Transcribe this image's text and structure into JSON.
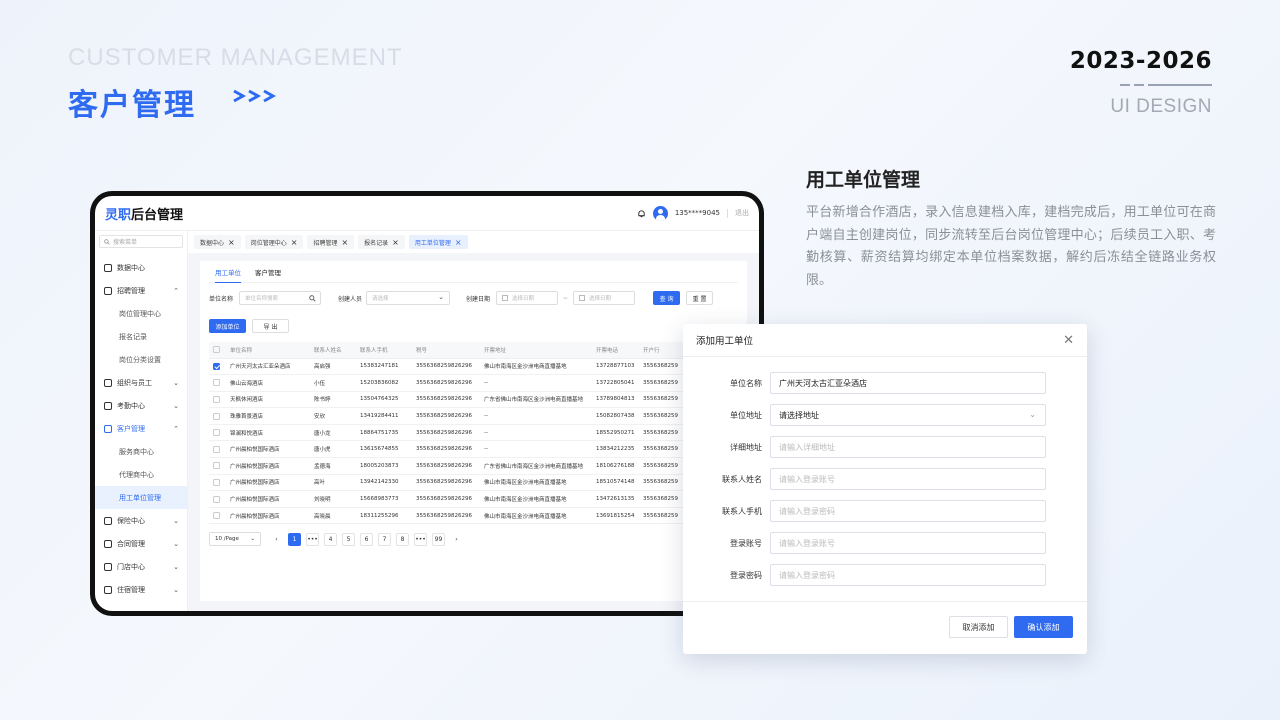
{
  "header": {
    "en_title": "CUSTOMER MANAGEMENT",
    "cn_title": "客户管理",
    "years": "2023-2026",
    "design": "UI DESIGN"
  },
  "description": {
    "title": "用工单位管理",
    "text": "平台新增合作酒店，录入信息建档入库，建档完成后，用工单位可在商户端自主创建岗位，同步流转至后台岗位管理中心；后续员工入职、考勤核算、薪资结算均绑定本单位档案数据，解约后冻结全链路业务权限。"
  },
  "app": {
    "logo_a": "灵职",
    "logo_b": "后台管理",
    "phone": "135****9045",
    "logout": "退出",
    "search_placeholder": "搜索菜单"
  },
  "sidebar": [
    {
      "label": "数据中心",
      "icon": "dashboard-icon",
      "chev": ""
    },
    {
      "label": "招聘管理",
      "icon": "recruit-icon",
      "chev": "⌃"
    },
    {
      "label": "岗位管理中心",
      "sub": true
    },
    {
      "label": "报名记录",
      "sub": true
    },
    {
      "label": "岗位分类设置",
      "sub": true
    },
    {
      "label": "组织与员工",
      "icon": "org-icon",
      "chev": "⌄"
    },
    {
      "label": "考勤中心",
      "icon": "attendance-icon",
      "chev": "⌄"
    },
    {
      "label": "客户管理",
      "icon": "customer-icon",
      "chev": "⌃",
      "highlight": true
    },
    {
      "label": "服务商中心",
      "sub": true
    },
    {
      "label": "代理商中心",
      "sub": true
    },
    {
      "label": "用工单位管理",
      "sub": true,
      "active": true
    },
    {
      "label": "保险中心",
      "icon": "insurance-icon",
      "chev": "⌄"
    },
    {
      "label": "合同管理",
      "icon": "contract-icon",
      "chev": "⌄"
    },
    {
      "label": "门店中心",
      "icon": "store-icon",
      "chev": "⌄"
    },
    {
      "label": "住宿管理",
      "icon": "dorm-icon",
      "chev": "⌄"
    }
  ],
  "tabs": [
    {
      "label": "数据中心"
    },
    {
      "label": "岗位管理中心"
    },
    {
      "label": "招聘管理"
    },
    {
      "label": "报名记录"
    },
    {
      "label": "用工单位管理",
      "active": true
    }
  ],
  "inner_tabs": [
    "用工单位",
    "客户管理"
  ],
  "filters": {
    "unit_label": "单位名称",
    "unit_placeholder": "单位名称搜索",
    "creator_label": "创建人员",
    "creator_placeholder": "请选择",
    "date_label": "创建日期",
    "date_start": "选择日期",
    "date_sep": "~",
    "date_end": "选择日期",
    "query": "查 询",
    "reset": "重 置",
    "add": "添加单位",
    "export": "导 出"
  },
  "table": {
    "headers": [
      "单位名称",
      "联系人姓名",
      "联系人手机",
      "税号",
      "开票地址",
      "开票电话",
      "开户行"
    ],
    "rows": [
      {
        "checked": true,
        "cells": [
          "广州天河太古汇亚朵酒店",
          "高启强",
          "15383247181",
          "3556368259826296",
          "佛山市南海区金沙洲电商直播基地",
          "13728877103",
          "3556368259"
        ]
      },
      {
        "cells": [
          "佛山云海酒店",
          "小伍",
          "15203836082",
          "3556368259826296",
          "--",
          "13722805041",
          "3556368259"
        ]
      },
      {
        "cells": [
          "天枫休闲酒店",
          "陈书婷",
          "13504764325",
          "3556368259826296",
          "广东省佛山市南海区金沙洲电商直播基地",
          "13789804813",
          "3556368259"
        ]
      },
      {
        "cells": [
          "珠雅首景酒店",
          "安欣",
          "13419284411",
          "3556368259826296",
          "--",
          "15082807438",
          "3556368259"
        ]
      },
      {
        "cells": [
          "锦澜和悦酒店",
          "唐小龙",
          "18864751735",
          "3556368259826296",
          "--",
          "18552950271",
          "3556368259"
        ]
      },
      {
        "cells": [
          "广州晨柏悦国际酒店",
          "唐小虎",
          "13615674855",
          "3556368259826296",
          "--",
          "13834212235",
          "3556368259"
        ]
      },
      {
        "cells": [
          "广州晨柏悦国际酒店",
          "孟德海",
          "18005203873",
          "3556368259826296",
          "广东省佛山市南海区金沙洲电商直播基地",
          "18106276188",
          "3556368259"
        ]
      },
      {
        "cells": [
          "广州晨柏悦国际酒店",
          "高叶",
          "13942142330",
          "3556368259826296",
          "佛山市南海区金沙洲电商直播基地",
          "18510574148",
          "3556368259"
        ]
      },
      {
        "cells": [
          "广州晨柏悦国际酒店",
          "刘晓明",
          "15668983773",
          "3556368259826296",
          "佛山市南海区金沙洲电商直播基地",
          "13472613135",
          "3556368259"
        ]
      },
      {
        "cells": [
          "广州晨柏悦国际酒店",
          "高晓晨",
          "18311255296",
          "3556368259826296",
          "佛山市南海区金沙洲电商直播基地",
          "13691815254",
          "3556368259"
        ]
      }
    ]
  },
  "pagination": {
    "page_size": "10 /Page",
    "pages": [
      "1",
      "•••",
      "4",
      "5",
      "6",
      "7",
      "8",
      "•••",
      "99"
    ],
    "current": "1"
  },
  "modal": {
    "title": "添加用工单位",
    "fields": [
      {
        "label": "单位名称",
        "value": "广州天河太古汇亚朵酒店",
        "filled": true
      },
      {
        "label": "单位地址",
        "value": "请选择地址",
        "filled": true,
        "select": true
      },
      {
        "label": "详细地址",
        "value": "请输入详细地址"
      },
      {
        "label": "联系人姓名",
        "value": "请输入登录账号"
      },
      {
        "label": "联系人手机",
        "value": "请输入登录密码"
      },
      {
        "label": "登录账号",
        "value": "请输入登录账号"
      },
      {
        "label": "登录密码",
        "value": "请输入登录密码"
      }
    ],
    "cancel": "取消添加",
    "confirm": "确认添加"
  },
  "colors": {
    "accent": "#2f6bf0"
  }
}
